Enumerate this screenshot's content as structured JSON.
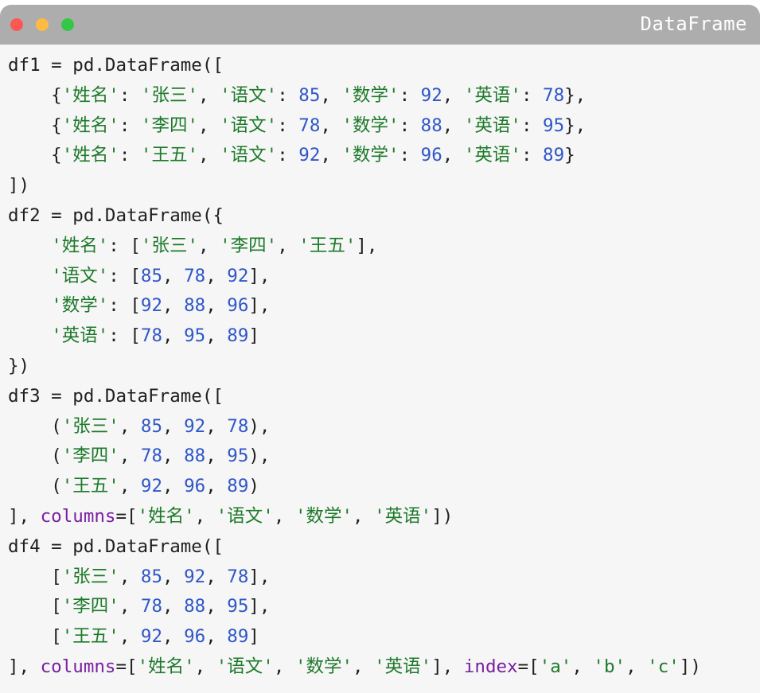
{
  "window": {
    "title": "DataFrame",
    "colors": {
      "titlebar": "#adadad",
      "close": "#fc5753",
      "minimize": "#fdbc40",
      "maximize": "#33c748",
      "string": "#1d7a2a",
      "number": "#2f57c7",
      "keyword": "#7a1fa2"
    }
  },
  "code_lines": [
    [
      [
        "p",
        "df1 = pd.DataFrame(["
      ]
    ],
    [
      [
        "p",
        "    {"
      ],
      [
        "s",
        "'姓名'"
      ],
      [
        "p",
        ": "
      ],
      [
        "s",
        "'张三'"
      ],
      [
        "p",
        ", "
      ],
      [
        "s",
        "'语文'"
      ],
      [
        "p",
        ": "
      ],
      [
        "n",
        "85"
      ],
      [
        "p",
        ", "
      ],
      [
        "s",
        "'数学'"
      ],
      [
        "p",
        ": "
      ],
      [
        "n",
        "92"
      ],
      [
        "p",
        ", "
      ],
      [
        "s",
        "'英语'"
      ],
      [
        "p",
        ": "
      ],
      [
        "n",
        "78"
      ],
      [
        "p",
        "},"
      ]
    ],
    [
      [
        "p",
        "    {"
      ],
      [
        "s",
        "'姓名'"
      ],
      [
        "p",
        ": "
      ],
      [
        "s",
        "'李四'"
      ],
      [
        "p",
        ", "
      ],
      [
        "s",
        "'语文'"
      ],
      [
        "p",
        ": "
      ],
      [
        "n",
        "78"
      ],
      [
        "p",
        ", "
      ],
      [
        "s",
        "'数学'"
      ],
      [
        "p",
        ": "
      ],
      [
        "n",
        "88"
      ],
      [
        "p",
        ", "
      ],
      [
        "s",
        "'英语'"
      ],
      [
        "p",
        ": "
      ],
      [
        "n",
        "95"
      ],
      [
        "p",
        "},"
      ]
    ],
    [
      [
        "p",
        "    {"
      ],
      [
        "s",
        "'姓名'"
      ],
      [
        "p",
        ": "
      ],
      [
        "s",
        "'王五'"
      ],
      [
        "p",
        ", "
      ],
      [
        "s",
        "'语文'"
      ],
      [
        "p",
        ": "
      ],
      [
        "n",
        "92"
      ],
      [
        "p",
        ", "
      ],
      [
        "s",
        "'数学'"
      ],
      [
        "p",
        ": "
      ],
      [
        "n",
        "96"
      ],
      [
        "p",
        ", "
      ],
      [
        "s",
        "'英语'"
      ],
      [
        "p",
        ": "
      ],
      [
        "n",
        "89"
      ],
      [
        "p",
        "}"
      ]
    ],
    [
      [
        "p",
        "])"
      ]
    ],
    [
      [
        "p",
        "df2 = pd.DataFrame({"
      ]
    ],
    [
      [
        "p",
        "    "
      ],
      [
        "s",
        "'姓名'"
      ],
      [
        "p",
        ": ["
      ],
      [
        "s",
        "'张三'"
      ],
      [
        "p",
        ", "
      ],
      [
        "s",
        "'李四'"
      ],
      [
        "p",
        ", "
      ],
      [
        "s",
        "'王五'"
      ],
      [
        "p",
        "],"
      ]
    ],
    [
      [
        "p",
        "    "
      ],
      [
        "s",
        "'语文'"
      ],
      [
        "p",
        ": ["
      ],
      [
        "n",
        "85"
      ],
      [
        "p",
        ", "
      ],
      [
        "n",
        "78"
      ],
      [
        "p",
        ", "
      ],
      [
        "n",
        "92"
      ],
      [
        "p",
        "],"
      ]
    ],
    [
      [
        "p",
        "    "
      ],
      [
        "s",
        "'数学'"
      ],
      [
        "p",
        ": ["
      ],
      [
        "n",
        "92"
      ],
      [
        "p",
        ", "
      ],
      [
        "n",
        "88"
      ],
      [
        "p",
        ", "
      ],
      [
        "n",
        "96"
      ],
      [
        "p",
        "],"
      ]
    ],
    [
      [
        "p",
        "    "
      ],
      [
        "s",
        "'英语'"
      ],
      [
        "p",
        ": ["
      ],
      [
        "n",
        "78"
      ],
      [
        "p",
        ", "
      ],
      [
        "n",
        "95"
      ],
      [
        "p",
        ", "
      ],
      [
        "n",
        "89"
      ],
      [
        "p",
        "]"
      ]
    ],
    [
      [
        "p",
        "})"
      ]
    ],
    [
      [
        "p",
        "df3 = pd.DataFrame(["
      ]
    ],
    [
      [
        "p",
        "    ("
      ],
      [
        "s",
        "'张三'"
      ],
      [
        "p",
        ", "
      ],
      [
        "n",
        "85"
      ],
      [
        "p",
        ", "
      ],
      [
        "n",
        "92"
      ],
      [
        "p",
        ", "
      ],
      [
        "n",
        "78"
      ],
      [
        "p",
        "),"
      ]
    ],
    [
      [
        "p",
        "    ("
      ],
      [
        "s",
        "'李四'"
      ],
      [
        "p",
        ", "
      ],
      [
        "n",
        "78"
      ],
      [
        "p",
        ", "
      ],
      [
        "n",
        "88"
      ],
      [
        "p",
        ", "
      ],
      [
        "n",
        "95"
      ],
      [
        "p",
        "),"
      ]
    ],
    [
      [
        "p",
        "    ("
      ],
      [
        "s",
        "'王五'"
      ],
      [
        "p",
        ", "
      ],
      [
        "n",
        "92"
      ],
      [
        "p",
        ", "
      ],
      [
        "n",
        "96"
      ],
      [
        "p",
        ", "
      ],
      [
        "n",
        "89"
      ],
      [
        "p",
        ")"
      ]
    ],
    [
      [
        "p",
        "], "
      ],
      [
        "k",
        "columns"
      ],
      [
        "p",
        "=["
      ],
      [
        "s",
        "'姓名'"
      ],
      [
        "p",
        ", "
      ],
      [
        "s",
        "'语文'"
      ],
      [
        "p",
        ", "
      ],
      [
        "s",
        "'数学'"
      ],
      [
        "p",
        ", "
      ],
      [
        "s",
        "'英语'"
      ],
      [
        "p",
        "])"
      ]
    ],
    [
      [
        "p",
        "df4 = pd.DataFrame(["
      ]
    ],
    [
      [
        "p",
        "    ["
      ],
      [
        "s",
        "'张三'"
      ],
      [
        "p",
        ", "
      ],
      [
        "n",
        "85"
      ],
      [
        "p",
        ", "
      ],
      [
        "n",
        "92"
      ],
      [
        "p",
        ", "
      ],
      [
        "n",
        "78"
      ],
      [
        "p",
        "],"
      ]
    ],
    [
      [
        "p",
        "    ["
      ],
      [
        "s",
        "'李四'"
      ],
      [
        "p",
        ", "
      ],
      [
        "n",
        "78"
      ],
      [
        "p",
        ", "
      ],
      [
        "n",
        "88"
      ],
      [
        "p",
        ", "
      ],
      [
        "n",
        "95"
      ],
      [
        "p",
        "],"
      ]
    ],
    [
      [
        "p",
        "    ["
      ],
      [
        "s",
        "'王五'"
      ],
      [
        "p",
        ", "
      ],
      [
        "n",
        "92"
      ],
      [
        "p",
        ", "
      ],
      [
        "n",
        "96"
      ],
      [
        "p",
        ", "
      ],
      [
        "n",
        "89"
      ],
      [
        "p",
        "]"
      ]
    ],
    [
      [
        "p",
        "], "
      ],
      [
        "k",
        "columns"
      ],
      [
        "p",
        "=["
      ],
      [
        "s",
        "'姓名'"
      ],
      [
        "p",
        ", "
      ],
      [
        "s",
        "'语文'"
      ],
      [
        "p",
        ", "
      ],
      [
        "s",
        "'数学'"
      ],
      [
        "p",
        ", "
      ],
      [
        "s",
        "'英语'"
      ],
      [
        "p",
        "], "
      ],
      [
        "k",
        "index"
      ],
      [
        "p",
        "=["
      ],
      [
        "s",
        "'a'"
      ],
      [
        "p",
        ", "
      ],
      [
        "s",
        "'b'"
      ],
      [
        "p",
        ", "
      ],
      [
        "s",
        "'c'"
      ],
      [
        "p",
        "])"
      ]
    ]
  ]
}
